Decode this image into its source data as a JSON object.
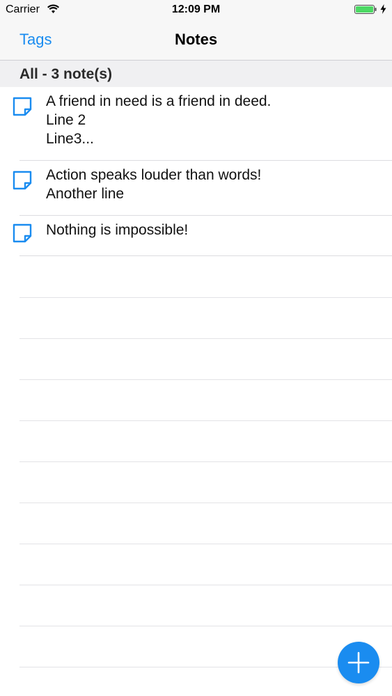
{
  "status_bar": {
    "carrier": "Carrier",
    "time": "12:09 PM"
  },
  "nav": {
    "left_button": "Tags",
    "title": "Notes"
  },
  "section": {
    "header": "All - 3 note(s)"
  },
  "notes": [
    {
      "text": "A friend in need is a friend in deed.\nLine 2\nLine3..."
    },
    {
      "text": "Action speaks louder than words!\nAnother line"
    },
    {
      "text": "Nothing is impossible!"
    }
  ],
  "colors": {
    "accent": "#1a8cf0",
    "battery": "#4cd964"
  },
  "icons": {
    "note": "note-icon",
    "add": "plus-icon"
  }
}
